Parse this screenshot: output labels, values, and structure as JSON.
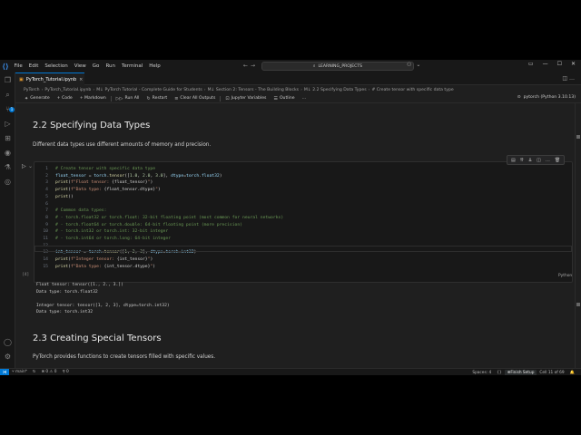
{
  "menu": {
    "items": [
      "File",
      "Edit",
      "Selection",
      "View",
      "Go",
      "Run",
      "Terminal",
      "Help"
    ],
    "search_text": "LEARNING_PROJECTS"
  },
  "tab": {
    "title": "PyTorch_Tutorial.ipynb",
    "close": "×"
  },
  "breadcrumb": [
    "PyTorch",
    "PyTorch_Tutorial.ipynb",
    "M↓ PyTorch Tutorial - Complete Guide for Students",
    "M↓ Section 2: Tensors - The Building Blocks",
    "M↓ 2.2 Specifying Data Types",
    "# Create tensor with specific data type"
  ],
  "toolbar": {
    "generate": "Generate",
    "code": "+ Code",
    "markdown": "+ Markdown",
    "run_all": "Run All",
    "restart": "Restart",
    "clear_outputs": "Clear All Outputs",
    "variables": "Jupyter Variables",
    "outline": "Outline",
    "kernel": "pytorch (Python 3.10.13)"
  },
  "content": {
    "heading1": "2.2 Specifying Data Types",
    "para1": "Different data types use different amounts of memory and precision.",
    "cell_exec": "[4]",
    "cell_lang": "Python",
    "heading2": "2.3 Creating Special Tensors",
    "para2": "PyTorch provides functions to create tensors filled with specific values."
  },
  "code_lines": [
    {
      "n": "1",
      "parts": [
        [
          "cm",
          "# Create tensor with specific data type"
        ]
      ]
    },
    {
      "n": "2",
      "parts": [
        [
          "kw",
          "float_tensor"
        ],
        [
          "pl",
          " = "
        ],
        [
          "kw",
          "torch"
        ],
        [
          "pl",
          "."
        ],
        [
          "fn",
          "tensor"
        ],
        [
          "pl",
          "(["
        ],
        [
          "num",
          "1.0"
        ],
        [
          "pl",
          ", "
        ],
        [
          "num",
          "2.0"
        ],
        [
          "pl",
          ", "
        ],
        [
          "num",
          "3.0"
        ],
        [
          "pl",
          "], "
        ],
        [
          "kw",
          "dtype"
        ],
        [
          "pl",
          "="
        ],
        [
          "kw",
          "torch"
        ],
        [
          "pl",
          "."
        ],
        [
          "kw",
          "float32"
        ],
        [
          "pl",
          ")"
        ]
      ]
    },
    {
      "n": "3",
      "parts": [
        [
          "fn",
          "print"
        ],
        [
          "pl",
          "("
        ],
        [
          "str",
          "f\"Float tensor: "
        ],
        [
          "pl",
          "{float_tensor}"
        ],
        [
          "str",
          "\""
        ],
        [
          "pl",
          ")"
        ]
      ]
    },
    {
      "n": "4",
      "parts": [
        [
          "fn",
          "print"
        ],
        [
          "pl",
          "("
        ],
        [
          "str",
          "f\"Data type: "
        ],
        [
          "pl",
          "{float_tensor.dtype}"
        ],
        [
          "str",
          "\""
        ],
        [
          "pl",
          ")"
        ]
      ]
    },
    {
      "n": "5",
      "parts": [
        [
          "fn",
          "print"
        ],
        [
          "pl",
          "()"
        ]
      ]
    },
    {
      "n": "6",
      "parts": [
        [
          "pl",
          ""
        ]
      ]
    },
    {
      "n": "7",
      "parts": [
        [
          "cm",
          "# Common data types:"
        ]
      ]
    },
    {
      "n": "8",
      "parts": [
        [
          "cm",
          "# - torch.float32 or torch.float: 32-bit floating point (most common for neural networks)"
        ]
      ]
    },
    {
      "n": "9",
      "parts": [
        [
          "cm",
          "# - torch.float64 or torch.double: 64-bit floating point (more precision)"
        ]
      ]
    },
    {
      "n": "10",
      "parts": [
        [
          "cm",
          "# - torch.int32 or torch.int: 32-bit integer"
        ]
      ]
    },
    {
      "n": "11",
      "parts": [
        [
          "cm",
          "# - torch.int64 or torch.long: 64-bit integer"
        ]
      ]
    },
    {
      "n": "12",
      "parts": [
        [
          "pl",
          ""
        ]
      ]
    },
    {
      "n": "13",
      "parts": [
        [
          "kw",
          "int_tensor"
        ],
        [
          "pl",
          " = "
        ],
        [
          "kw",
          "torch"
        ],
        [
          "pl",
          "."
        ],
        [
          "fn",
          "tensor"
        ],
        [
          "pl",
          "(["
        ],
        [
          "num",
          "1"
        ],
        [
          "pl",
          ", "
        ],
        [
          "num",
          "2"
        ],
        [
          "pl",
          ", "
        ],
        [
          "num",
          "3"
        ],
        [
          "pl",
          "], "
        ],
        [
          "kw",
          "dtype"
        ],
        [
          "pl",
          "="
        ],
        [
          "kw",
          "torch"
        ],
        [
          "pl",
          "."
        ],
        [
          "kw",
          "int32"
        ],
        [
          "pl",
          ")"
        ]
      ]
    },
    {
      "n": "14",
      "parts": [
        [
          "fn",
          "print"
        ],
        [
          "pl",
          "("
        ],
        [
          "str",
          "f\"Integer tensor: "
        ],
        [
          "pl",
          "{int_tensor}"
        ],
        [
          "str",
          "\""
        ],
        [
          "pl",
          ")"
        ]
      ]
    },
    {
      "n": "15",
      "parts": [
        [
          "fn",
          "print"
        ],
        [
          "pl",
          "("
        ],
        [
          "str",
          "f\"Data type: "
        ],
        [
          "pl",
          "{int_tensor.dtype}"
        ],
        [
          "str",
          "\""
        ],
        [
          "pl",
          ")"
        ]
      ]
    }
  ],
  "output_lines": [
    "Float tensor: tensor([1., 2., 3.])",
    "Data type: torch.float32",
    "",
    "Integer tensor: tensor([1, 2, 3], dtype=torch.int32)",
    "Data type: torch.int32"
  ],
  "status": {
    "branch": "main*",
    "errors": "⊗ 0 ⚠ 0",
    "ports": "0",
    "spaces": "Spaces: 4",
    "finish_setup": "Finish Setup",
    "cell_pos": "Cell 11 of 69"
  }
}
